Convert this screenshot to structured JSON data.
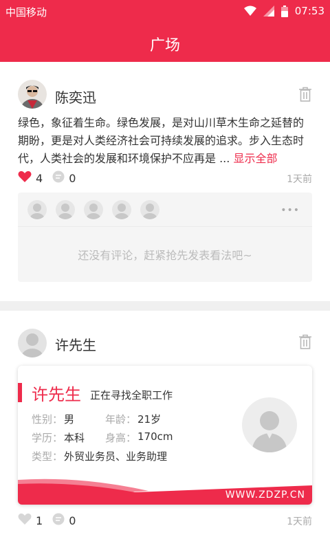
{
  "status_bar": {
    "carrier": "中国移动",
    "time": "07:53"
  },
  "app_bar": {
    "title": "广场"
  },
  "posts": [
    {
      "username": "陈奕迅",
      "text": "绿色，象征着生命。绿色发展，是对山川草木生命之延替的期盼，更是对人类经济社会可持续发展的追求。步入生态时代，人类社会的发展和环境保护不应再是 ...",
      "show_all": "显示全部",
      "likes": "4",
      "comments": "0",
      "time": "1天前",
      "no_comment": "还没有评论，赶紧抢先发表看法吧~"
    },
    {
      "username": "许先生",
      "likes": "1",
      "comments": "0",
      "time": "1天前",
      "resume": {
        "name": "许先生",
        "status": "正在寻找全职工作",
        "gender_label": "性别：",
        "gender": "男",
        "age_label": "年龄：",
        "age": "21岁",
        "edu_label": "学历：",
        "edu": "本科",
        "height_label": "身高：",
        "height": "170cm",
        "type_label": "类型：",
        "type": "外贸业务员、业务助理",
        "site": "WWW.ZDZP.CN"
      }
    }
  ],
  "colors": {
    "accent": "#ee2b4b"
  },
  "icons": [
    "wifi-icon",
    "signal-icon",
    "battery-icon",
    "trash-icon",
    "heart-icon",
    "comment-icon",
    "more-icon",
    "avatar-placeholder-icon"
  ]
}
